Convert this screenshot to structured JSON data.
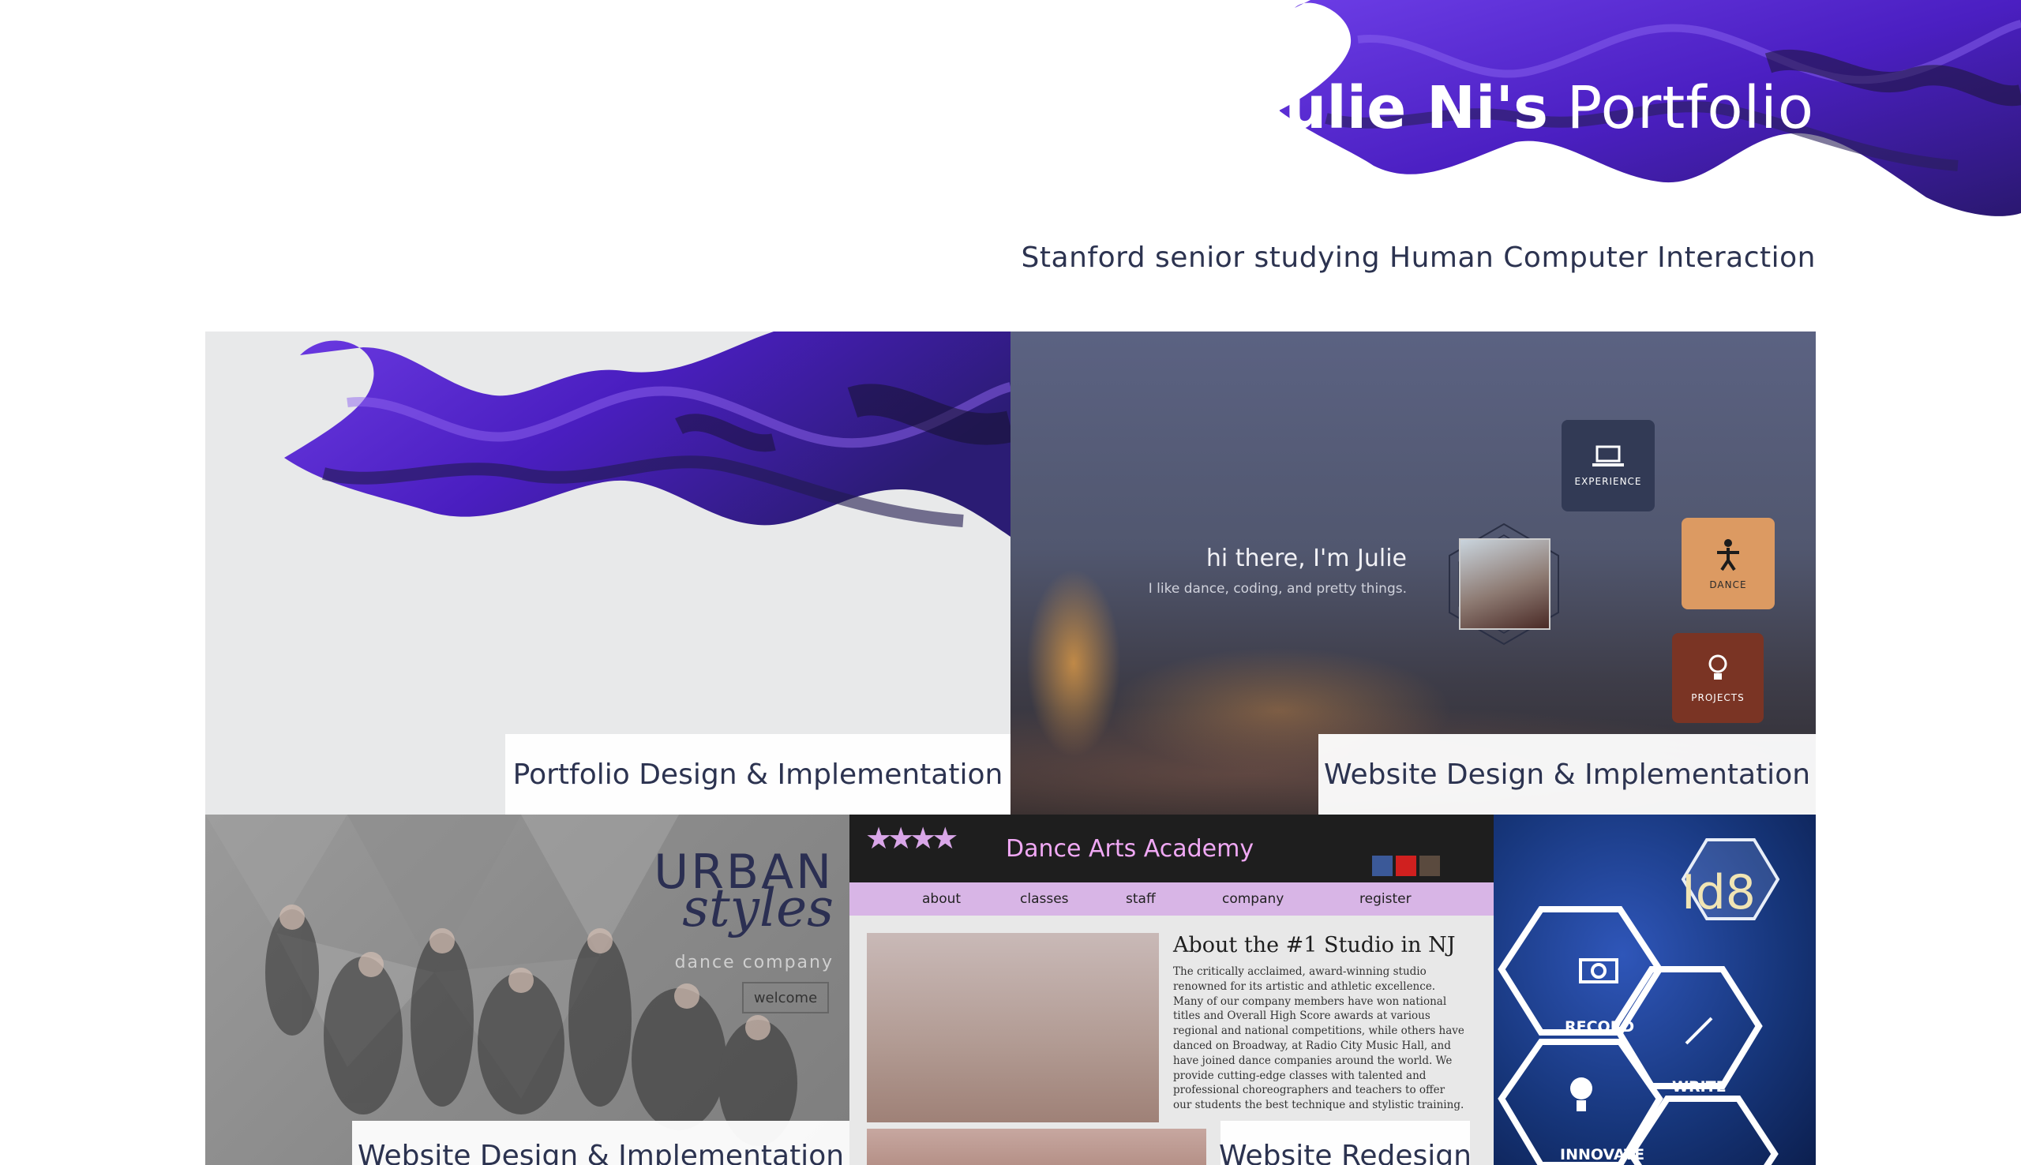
{
  "header": {
    "title_bold": "Julie Ni's",
    "title_light": "Portfolio",
    "tagline": "Stanford senior studying Human Computer Interaction"
  },
  "colors": {
    "brand_purple": "#5a2ed0",
    "text_navy": "#2c3350",
    "caption_bg": "#ffffff"
  },
  "projects": [
    {
      "caption": "Portfolio Design & Implementation"
    },
    {
      "caption": "Website Design & Implementation",
      "greeting": "hi there, I'm Julie",
      "subtitle": "I like dance, coding, and pretty things.",
      "nav": [
        {
          "label": "EXPERIENCE",
          "icon": "laptop-icon"
        },
        {
          "label": "DANCE",
          "icon": "dancer-icon"
        },
        {
          "label": "PROJECTS",
          "icon": "lightbulb-icon"
        }
      ]
    },
    {
      "caption": "Website Design & Implementation",
      "logo_line1": "URBAN",
      "logo_line2": "styles",
      "logo_line3": "dance company",
      "button": "welcome"
    },
    {
      "caption": "Website Redesign",
      "site_name": "Dance Arts Academy",
      "nav": [
        "about",
        "classes",
        "staff",
        "company",
        "register"
      ],
      "heading": "About the #1 Studio in NJ",
      "body": "The critically acclaimed, award-winning studio renowned for its artistic and athletic excellence. Many of our company members have won national titles and Overall High Score awards at various regional and national competitions, while others have danced on Broadway, at Radio City Music Hall, and have joined dance companies around the world. We provide cutting-edge classes with talented and professional choreographers and teachers to offer our students the best technique and stylistic training."
    },
    {
      "logo": "Id8",
      "hexes": [
        "RECORD",
        "WRITE",
        "INNOVATE"
      ]
    }
  ]
}
